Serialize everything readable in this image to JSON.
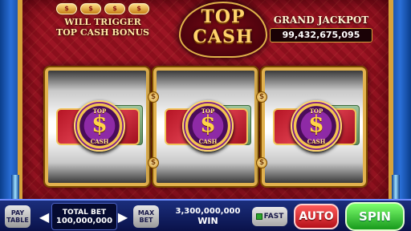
{
  "header": {
    "bonus_gems": [
      "$",
      "$",
      "$",
      "$"
    ],
    "bonus_line1": "WILL TRIGGER",
    "bonus_line2": "TOP CASH BONUS",
    "logo_line1": "TOP",
    "logo_line2": "CASH",
    "jackpot_title": "GRAND JACKPOT",
    "jackpot_value": "99,432,675,095"
  },
  "reels": [
    {
      "top": "TOP",
      "symbol": "$",
      "bottom": "CASH"
    },
    {
      "top": "TOP",
      "symbol": "$",
      "bottom": "CASH"
    },
    {
      "top": "TOP",
      "symbol": "$",
      "bottom": "CASH"
    }
  ],
  "controls": {
    "paytable_line1": "PAY",
    "paytable_line2": "TABLE",
    "left_arrow": "◀",
    "right_arrow": "▶",
    "total_bet_label": "TOTAL BET",
    "total_bet_value": "100,000,000",
    "maxbet_line1": "MAX",
    "maxbet_line2": "BET",
    "win_amount": "3,300,000,000",
    "win_label": "WIN",
    "fast_label": "FAST",
    "auto_label": "AUTO",
    "spin_label": "SPIN"
  },
  "colors": {
    "machine_red": "#9c1524",
    "gold": "#e2b24e",
    "spin_green": "#189a1c",
    "auto_red": "#b5101a"
  }
}
